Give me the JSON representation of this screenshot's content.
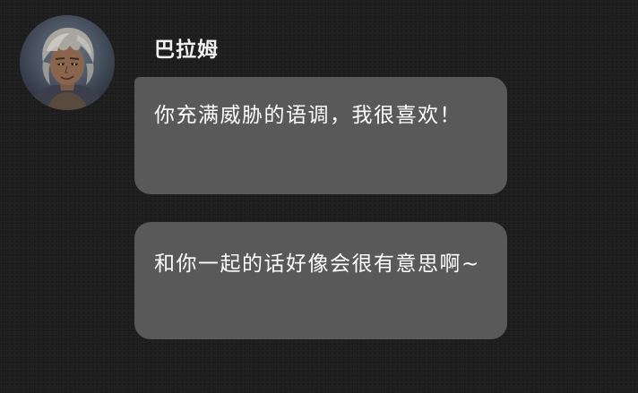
{
  "chat": {
    "sender": {
      "name": "巴拉姆",
      "avatar_icon": "character-portrait-avatar"
    },
    "messages": [
      {
        "text": "你充满威胁的语调，我很喜欢！"
      },
      {
        "text": "和你一起的话好像会很有意思啊~"
      }
    ]
  },
  "colors": {
    "background": "#1e1e1e",
    "bubble": "#595959",
    "text": "#ffffff"
  }
}
